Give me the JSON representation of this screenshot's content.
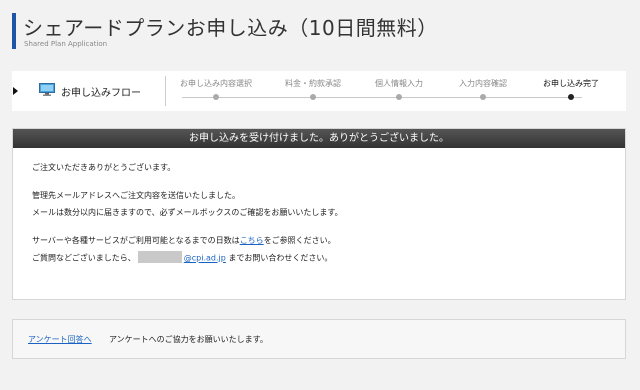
{
  "header": {
    "title": "シェアードプランお申し込み（10日間無料）",
    "subtitle": "Shared Plan Application"
  },
  "flow": {
    "label": "お申し込みフロー",
    "icon": "monitor-icon",
    "steps": [
      {
        "label": "お申し込み内容選択",
        "active": false
      },
      {
        "label": "料金・約款承認",
        "active": false
      },
      {
        "label": "個人情報入力",
        "active": false
      },
      {
        "label": "入力内容確認",
        "active": false
      },
      {
        "label": "お申し込み完了",
        "active": true
      }
    ]
  },
  "message": {
    "heading": "お申し込みを受け付けました。ありがとうございました。",
    "line1": "ご注文いただきありがとうございます。",
    "line2": "管理先メールアドレスへご注文内容を送信いたしました。",
    "line3": "メールは数分以内に届きますので、必ずメールボックスのご確認をお願いいたします。",
    "line4_pre": "サーバーや各種サービスがご利用可能となるまでの日数は",
    "line4_link": "こちら",
    "line4_post": "をご参照ください。",
    "line5_pre": "ご質問などございましたら、",
    "line5_email_domain": "@cpi.ad.jp",
    "line5_post": " までお問い合わせください。"
  },
  "survey": {
    "link_label": "アンケート回答へ",
    "text": "アンケートへのご協力をお願いいたします。"
  },
  "colors": {
    "accent": "#1f55a8",
    "link": "#1a63c4",
    "heading_bg": "#3f3f3f"
  }
}
